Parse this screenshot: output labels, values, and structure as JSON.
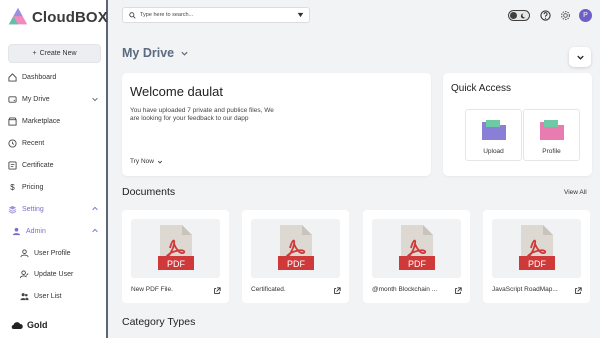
{
  "app": {
    "name": "CloudBOX"
  },
  "sidebar": {
    "create_label": "Create New",
    "items": [
      {
        "label": "Dashboard",
        "icon": "home-icon"
      },
      {
        "label": "My Drive",
        "icon": "drive-icon"
      },
      {
        "label": "Marketplace",
        "icon": "store-icon"
      },
      {
        "label": "Recent",
        "icon": "clock-icon"
      },
      {
        "label": "Certificate",
        "icon": "certificate-icon"
      },
      {
        "label": "Pricing",
        "icon": "dollar-icon"
      },
      {
        "label": "Setting",
        "icon": "settings-icon"
      },
      {
        "label": "Admin",
        "icon": "admin-icon"
      },
      {
        "label": "User Profile",
        "icon": "user-icon"
      },
      {
        "label": "Update User",
        "icon": "user-edit-icon"
      },
      {
        "label": "User List",
        "icon": "users-icon"
      }
    ],
    "plan": "Gold",
    "accent": "#7b6dd0"
  },
  "topbar": {
    "search_placeholder": "Type here to search...",
    "avatar_initial": "P"
  },
  "main": {
    "title": "My Drive",
    "welcome": {
      "heading": "Welcome daulat",
      "message": "You have uploaded 7 private and publice files, We are looking for your feedback to our dapp",
      "cta": "Try Now"
    },
    "quick_access": {
      "title": "Quick Access",
      "tiles": [
        {
          "label": "Upload",
          "color": "#8a7fd6"
        },
        {
          "label": "Profile",
          "color": "#e87cb0"
        }
      ]
    },
    "documents": {
      "title": "Documents",
      "view_all": "View All",
      "badge": "PDF",
      "items": [
        {
          "name": "New PDF File."
        },
        {
          "name": "Certificated."
        },
        {
          "name": "@month Blockchain ..."
        },
        {
          "name": "JavaScript RoadMap..."
        }
      ]
    },
    "categories_title": "Category Types"
  }
}
